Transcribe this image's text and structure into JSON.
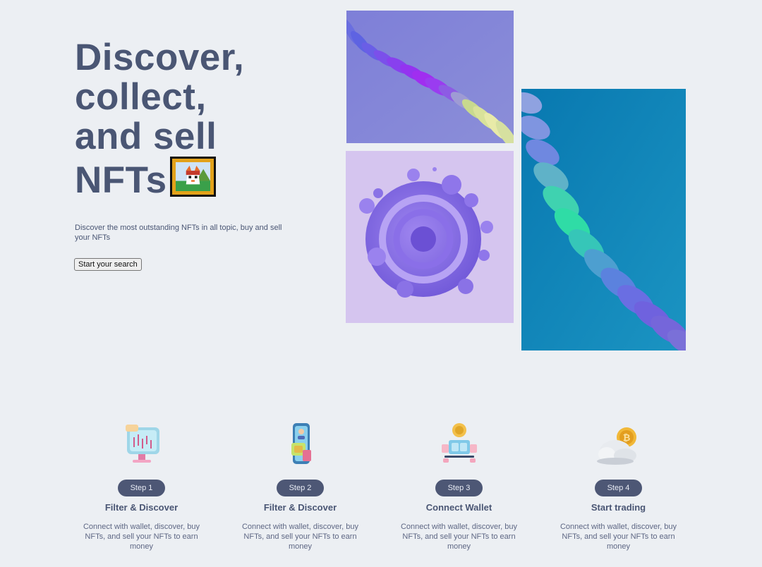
{
  "hero": {
    "title_lines": [
      "Discover,",
      "collect,",
      "and sell",
      "NFTs"
    ],
    "subtitle": "Discover the most outstanding NFTs in all topic, buy and sell your NFTs",
    "cta_label": "Start your search"
  },
  "steps": [
    {
      "badge": "Step 1",
      "title": "Filter & Discover",
      "desc": "Connect with wallet, discover, buy NFTs, and sell your NFTs to earn money",
      "icon": "chart-monitor-icon"
    },
    {
      "badge": "Step 2",
      "title": "Filter & Discover",
      "desc": "Connect with wallet, discover, buy NFTs, and sell your NFTs to earn money",
      "icon": "phone-card-icon"
    },
    {
      "badge": "Step 3",
      "title": "Connect Wallet",
      "desc": "Connect with wallet, discover, buy NFTs, and sell your NFTs to earn money",
      "icon": "wallet-coin-icon"
    },
    {
      "badge": "Step 4",
      "title": "Start trading",
      "desc": "Connect with wallet, discover, buy NFTs, and sell your NFTs to earn money",
      "icon": "cloud-bitcoin-icon"
    }
  ],
  "colors": {
    "background": "#eceff3",
    "heading": "#4a5674",
    "pill": "#4d5775",
    "nft_frame": "#e3a21a"
  }
}
